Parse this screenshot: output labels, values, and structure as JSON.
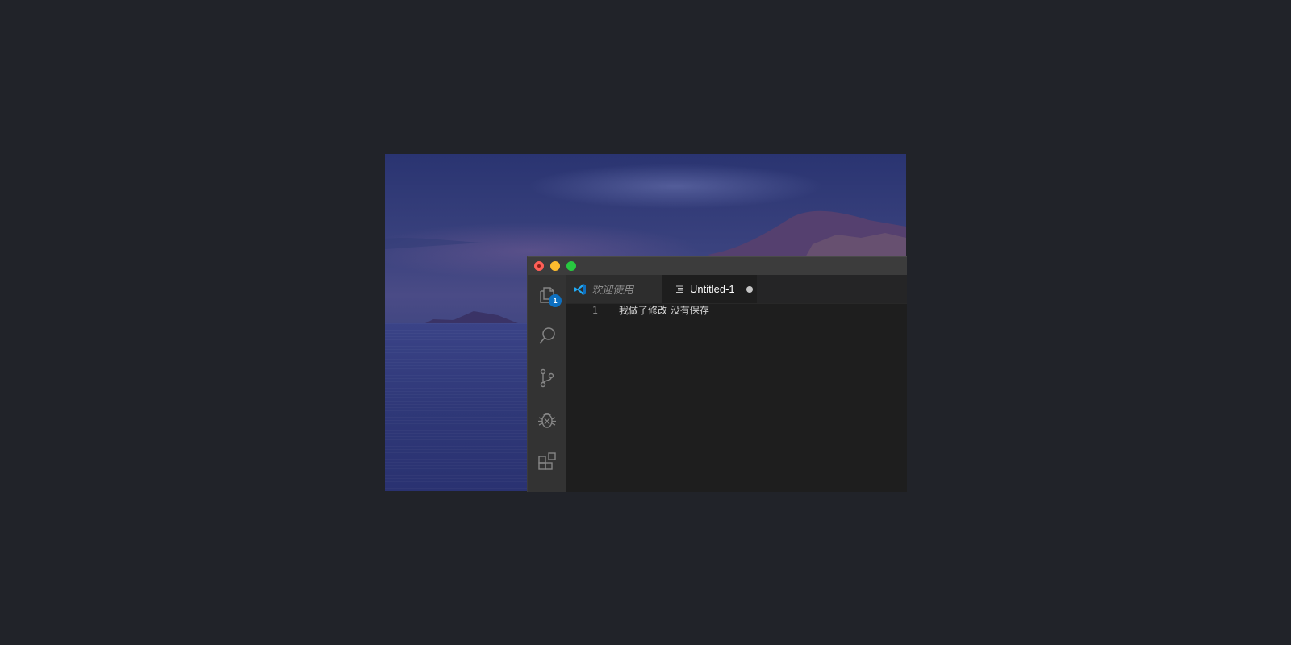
{
  "window": {
    "traffic_lights": [
      "close",
      "minimize",
      "maximize"
    ]
  },
  "activity_bar": {
    "items": [
      {
        "icon": "files-icon",
        "badge": "1"
      },
      {
        "icon": "search-icon"
      },
      {
        "icon": "source-control-icon"
      },
      {
        "icon": "debug-icon"
      },
      {
        "icon": "extensions-icon"
      }
    ],
    "badge_color": "#0e70c0"
  },
  "tabs": [
    {
      "label": "欢迎使用",
      "icon": "vscode-logo-icon",
      "active": false,
      "italic": true
    },
    {
      "label": "Untitled-1",
      "icon": "text-file-icon",
      "active": true,
      "dirty": true
    }
  ],
  "editor": {
    "lines": [
      {
        "number": "1",
        "text": "我做了修改 没有保存"
      }
    ]
  },
  "colors": {
    "page_background": "#212329",
    "activity_bar": "#333333",
    "editor_background": "#1e1e1e",
    "accent": "#0e70c0"
  }
}
